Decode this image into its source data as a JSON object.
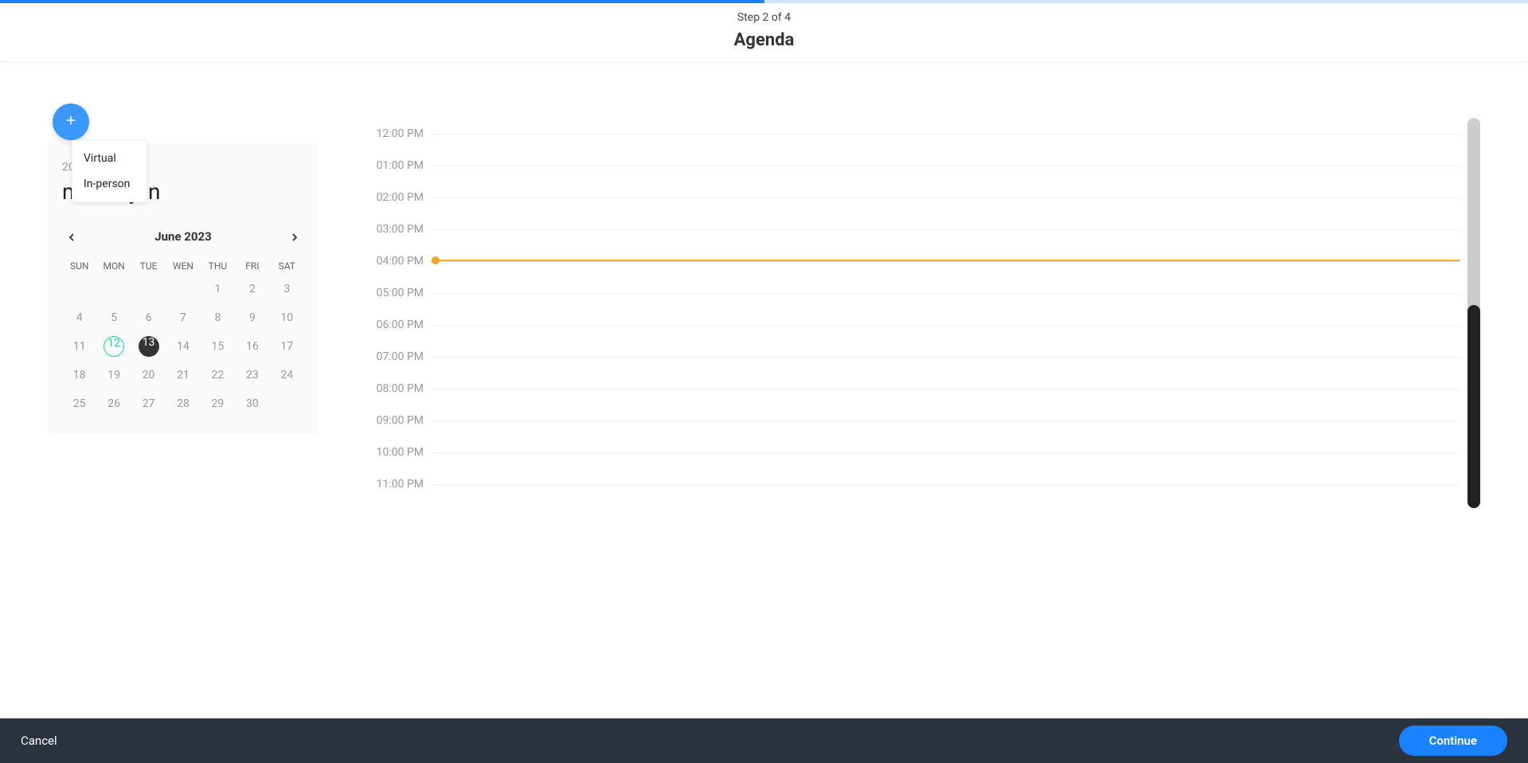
{
  "progress": {
    "percent": 50
  },
  "header": {
    "step_label": "Step 2 of 4",
    "title": "Agenda"
  },
  "fab_menu": {
    "option_virtual": "Virtual",
    "option_inperson": "In-person"
  },
  "calendar": {
    "year": "2023",
    "range_label": "mo 12 jun",
    "month_label": "June 2023",
    "dow": [
      "SUN",
      "MON",
      "TUE",
      "WEN",
      "THU",
      "FRI",
      "SAT"
    ],
    "weeks": [
      [
        "",
        "",
        "",
        "",
        "1",
        "2",
        "3"
      ],
      [
        "4",
        "5",
        "6",
        "7",
        "8",
        "9",
        "10"
      ],
      [
        "11",
        "12",
        "13",
        "14",
        "15",
        "16",
        "17"
      ],
      [
        "18",
        "19",
        "20",
        "21",
        "22",
        "23",
        "24"
      ],
      [
        "25",
        "26",
        "27",
        "28",
        "29",
        "30",
        ""
      ]
    ],
    "today": "12",
    "selected": "13"
  },
  "timegrid": {
    "hours": [
      "12:00 PM",
      "01:00 PM",
      "02:00 PM",
      "03:00 PM",
      "04:00 PM",
      "05:00 PM",
      "06:00 PM",
      "07:00 PM",
      "08:00 PM",
      "09:00 PM",
      "10:00 PM",
      "11:00 PM"
    ],
    "now_row_index": 4,
    "now_offset_fraction": 0.45,
    "scroll_thumb_percent_top": 48,
    "scroll_thumb_percent_height": 52
  },
  "footer": {
    "cancel": "Cancel",
    "continue": "Continue"
  }
}
